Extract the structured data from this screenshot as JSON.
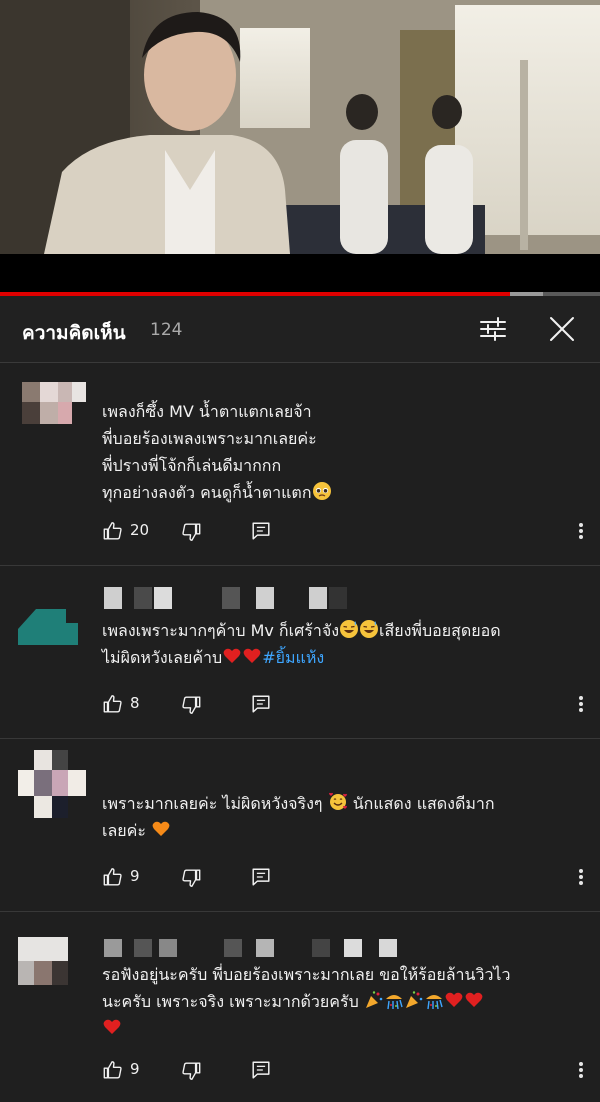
{
  "video": {
    "progress_fraction": 0.85,
    "buffer_fraction": 0.905
  },
  "comments_header": {
    "title": "ความคิดเห็น",
    "count": "124"
  },
  "comments": [
    {
      "lines": [
        "เพลงก็ซึ้ง MV น้ำตาแตกเลยจ้า",
        "พี่บอยร้องเพลงเพราะมากเลยค่ะ",
        "พี่ปรางพี่โจ้กก็เล่นดีมากกก",
        "ทุกอย่างลงตัว คนดูก็น้ำตาแตก"
      ],
      "likes": "20"
    },
    {
      "lines": [
        "เพลงเพราะมากๆค้าบ Mv ก็เศร้าจัง",
        "เสียงพี่บอยสุดยอด",
        "ไม่ผิดหวังเลยค้าบ",
        "#ยิ้มแห้ง"
      ],
      "likes": "8"
    },
    {
      "lines": [
        "เพราะมากเลยค่ะ ไม่ผิดหวังจริงๆ",
        "นักแสดง แสดงดีมาก",
        "เลยค่ะ"
      ],
      "likes": "9"
    },
    {
      "lines": [
        "รอฟังอยู่นะครับ พี่บอยร้องเพราะมากเลย ขอให้ร้อยล้านวิวไว",
        "นะครับ เพราะจริง เพราะมากด้วยครับ"
      ],
      "likes": "9"
    }
  ],
  "icons": {
    "like": "thumbs-up-icon",
    "dislike": "thumbs-down-icon",
    "reply": "reply-comment-icon",
    "more": "more-vertical-icon",
    "filter": "sort-sliders-icon",
    "close": "close-icon"
  },
  "colors": {
    "background": "#1f1f1f",
    "progress": "#e00000",
    "hashtag": "#3ea6ff",
    "text": "#f1f1f1"
  }
}
